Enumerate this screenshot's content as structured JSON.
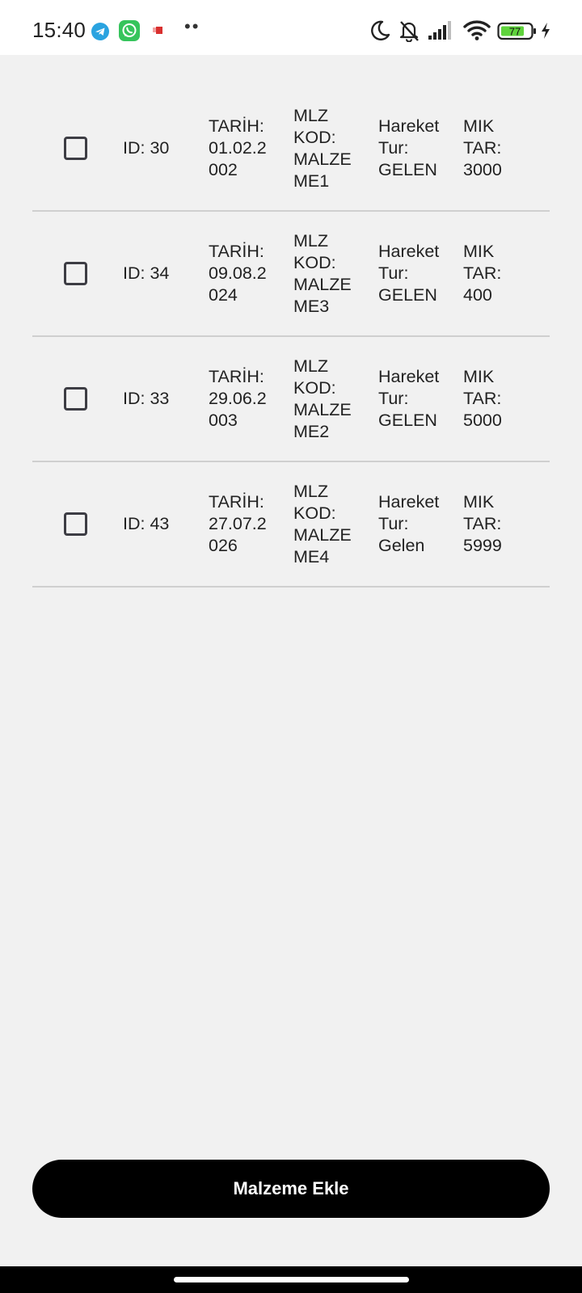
{
  "status_bar": {
    "time": "15:40",
    "battery_level": "77",
    "notification_icons": [
      "telegram-icon",
      "whatsapp-icon",
      "app-notification-icon",
      "more-dots-icon"
    ],
    "system_icons": [
      "moon-icon",
      "bell-off-icon",
      "signal-icon",
      "wifi-icon",
      "battery-icon",
      "charging-icon"
    ],
    "colors": {
      "telegram": "#2aa3e0",
      "whatsapp": "#36c45c",
      "battery_fill": "#5fd33c"
    }
  },
  "records": [
    {
      "id": "ID: 30",
      "date": "TARİH:\n01.02.2\n002",
      "code": "MLZ\nKOD:\nMALZE\nME1",
      "type": "Hareket\nTur:\nGELEN",
      "qty": "MIK\nTAR:\n3000",
      "checked": false
    },
    {
      "id": "ID: 34",
      "date": "TARİH:\n09.08.2\n024",
      "code": "MLZ\nKOD:\nMALZE\nME3",
      "type": "Hareket\nTur:\nGELEN",
      "qty": "MIK\nTAR:\n400",
      "checked": false
    },
    {
      "id": "ID: 33",
      "date": "TARİH:\n29.06.2\n003",
      "code": "MLZ\nKOD:\nMALZE\nME2",
      "type": "Hareket\nTur:\nGELEN",
      "qty": "MIK\nTAR:\n5000",
      "checked": false
    },
    {
      "id": "ID: 43",
      "date": "TARİH:\n27.07.2\n026",
      "code": "MLZ\nKOD:\nMALZE\nME4",
      "type": "Hareket\nTur:\nGelen",
      "qty": "MIK\nTAR:\n5999",
      "checked": false
    }
  ],
  "actions": {
    "add_label": "Malzeme Ekle"
  },
  "theme": {
    "background": "#f1f1f1",
    "button_bg": "#000000",
    "button_text": "#ffffff",
    "divider": "#cfcfcf"
  }
}
